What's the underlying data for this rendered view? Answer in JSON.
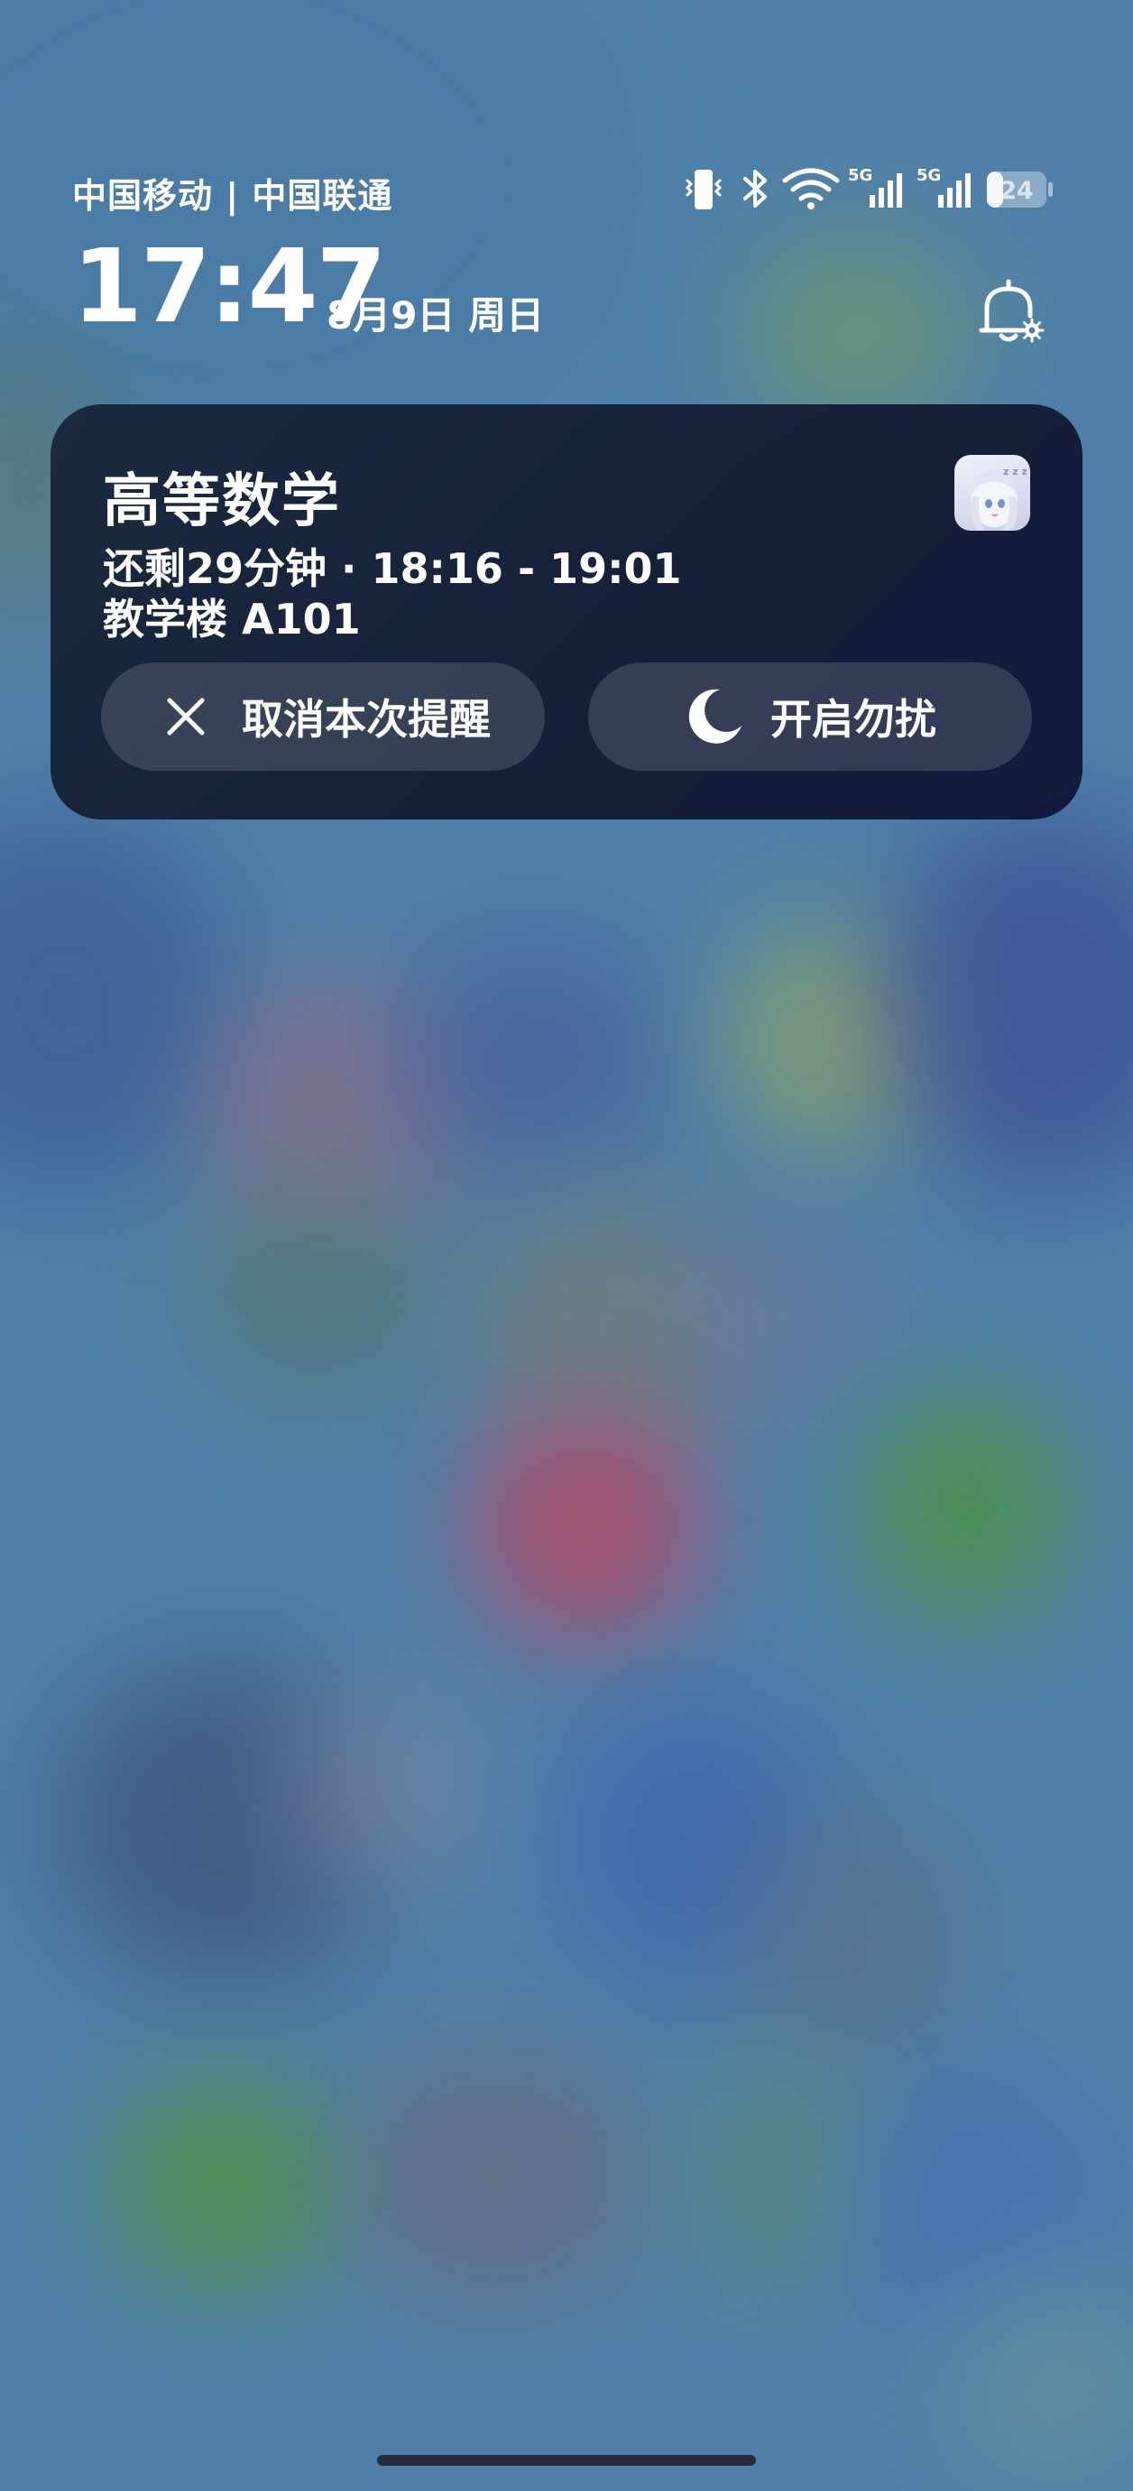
{
  "status_bar": {
    "carrier": "中国移动 | 中国联通",
    "battery_level": "24",
    "network_1": "5G",
    "network_2": "5G",
    "icons": [
      "vibrate-icon",
      "bluetooth-icon",
      "wifi-icon",
      "signal-5g-icon",
      "signal-5g-icon",
      "battery-icon"
    ]
  },
  "lockscreen": {
    "time": "17:47",
    "date": "8月9日 周日"
  },
  "notification": {
    "title": "高等数学",
    "detail": "还剩29分钟 · 18:16 - 19:01",
    "location": "教学楼 A101",
    "actions": {
      "cancel": "取消本次提醒",
      "dnd": "开启勿扰"
    }
  },
  "colors": {
    "wallpaper_base": "#4f7fa8",
    "notification_bg": "#18263a"
  }
}
